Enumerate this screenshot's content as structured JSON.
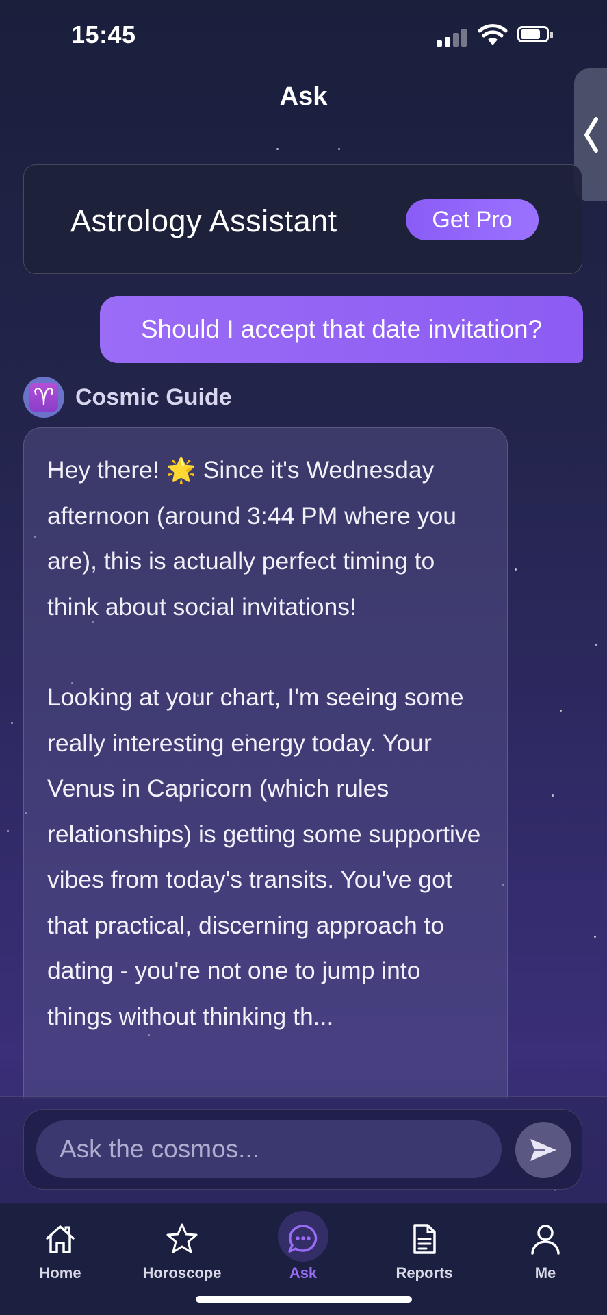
{
  "status_bar": {
    "time": "15:45"
  },
  "nav": {
    "title": "Ask"
  },
  "assistant_card": {
    "title": "Astrology Assistant",
    "pro_button": "Get Pro"
  },
  "chat": {
    "user_message": "Should I accept that date invitation?",
    "guide_name": "Cosmic Guide",
    "guide_avatar_symbol": "♈",
    "reply_paragraphs": [
      "Hey there! 🌟 Since it's Wednesday afternoon (around 3:44 PM where you are), this is actually perfect timing to think about social invitations!",
      "Looking at your chart, I'm seeing some really interesting energy today. Your Venus in Capricorn (which rules relationships) is getting some supportive vibes from today's transits. You've got that practical, discerning approach to dating - you're not one to jump into things without thinking th..."
    ]
  },
  "input": {
    "placeholder": "Ask the cosmos..."
  },
  "tabs": [
    {
      "label": "Home",
      "icon": "home-icon"
    },
    {
      "label": "Horoscope",
      "icon": "star-icon"
    },
    {
      "label": "Ask",
      "icon": "chat-bubble-icon",
      "active": true
    },
    {
      "label": "Reports",
      "icon": "document-icon"
    },
    {
      "label": "Me",
      "icon": "user-icon"
    }
  ],
  "colors": {
    "accent": "#8C5CF3",
    "tab_bar": "#1B2040",
    "background_top": "#1A1F3C",
    "background_bottom": "#3A2F78"
  }
}
